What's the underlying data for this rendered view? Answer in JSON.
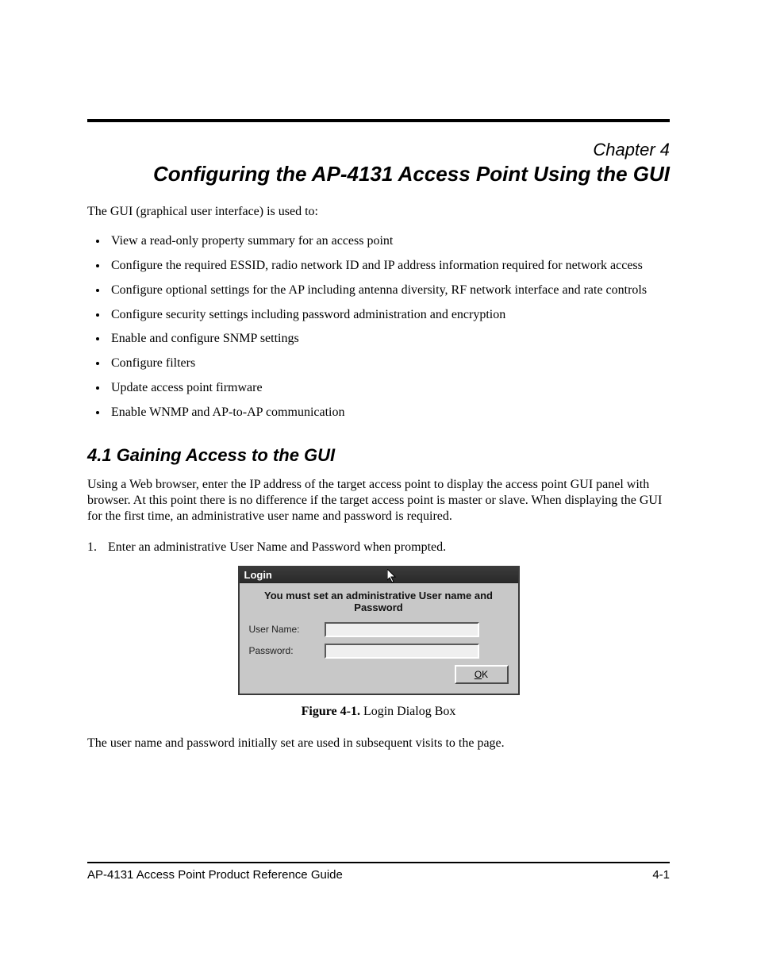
{
  "chapter": {
    "label": "Chapter 4",
    "title": "Configuring the AP-4131 Access Point Using the GUI"
  },
  "intro": "The GUI (graphical user interface) is used to:",
  "bullets": [
    "View a read-only property summary for an access point",
    "Configure the required ESSID, radio network ID and IP address information required for network access",
    "Configure optional settings for the AP including antenna diversity, RF network interface and rate controls",
    "Configure security settings including password administration and encryption",
    "Enable and configure SNMP settings",
    "Configure filters",
    "Update access point firmware",
    "Enable WNMP and AP-to-AP communication"
  ],
  "section": {
    "title": "4.1 Gaining Access to the GUI",
    "para": "Using a Web browser, enter the IP address of the target access point to display the access point GUI panel with browser. At this point there is no difference if the target access point is master or slave. When displaying the GUI for the first time, an administrative user name and password is required.",
    "step": {
      "num": "1.",
      "text": "Enter an administrative User Name and Password when prompted."
    }
  },
  "dialog": {
    "title": "Login",
    "message": "You must set an administrative User name and Password",
    "username_label": "User Name:",
    "password_label": "Password:",
    "username_value": "",
    "password_value": "",
    "ok_label_pre": "",
    "ok_label_u": "O",
    "ok_label_post": "K"
  },
  "figure": {
    "label": "Figure 4-1.",
    "title": "Login Dialog Box"
  },
  "post_para": "The user name and password initially set are used in subsequent visits to the page.",
  "footer": {
    "left": "AP-4131 Access Point Product Reference Guide",
    "right": "4-1"
  }
}
